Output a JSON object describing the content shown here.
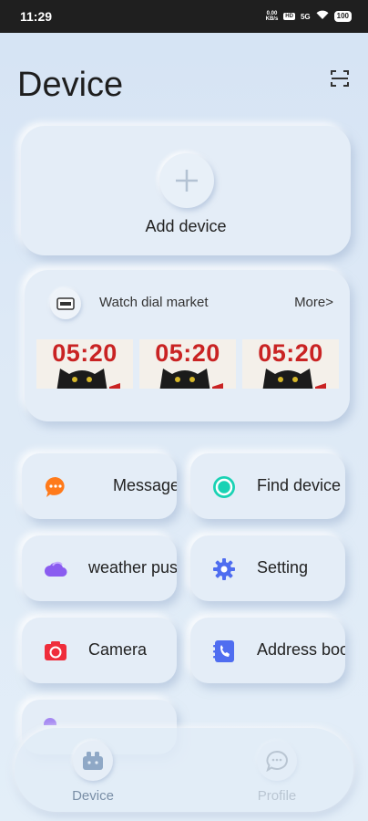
{
  "status_bar": {
    "time": "11:29",
    "speed_value": "0.00",
    "speed_unit": "KB/s",
    "sim_badge": "HD",
    "signal": "5G",
    "battery": "100"
  },
  "header": {
    "title": "Device",
    "scan_icon": "scan-icon"
  },
  "add_device": {
    "label": "Add device"
  },
  "dial_market": {
    "title": "Watch dial market",
    "more_label": "More>",
    "dials": [
      {
        "time": "05:20"
      },
      {
        "time": "05:20"
      },
      {
        "time": "05:20"
      }
    ]
  },
  "features": [
    {
      "label": "Message",
      "icon": "chat-bubble-icon",
      "color": "#ff7a1a"
    },
    {
      "label": "Find device",
      "icon": "find-device-icon",
      "color": "#19d2b4"
    },
    {
      "label": "weather push",
      "icon": "cloud-icon",
      "color": "#8a5cf0"
    },
    {
      "label": "Setting",
      "icon": "gear-icon",
      "color": "#4f6df0"
    },
    {
      "label": "Camera",
      "icon": "camera-icon",
      "color": "#ef2d3b"
    },
    {
      "label": "Address book",
      "icon": "address-book-icon",
      "color": "#4f6df0"
    }
  ],
  "bottom_nav": {
    "items": [
      {
        "label": "Device",
        "icon": "device-icon",
        "active": true
      },
      {
        "label": "Profile",
        "icon": "profile-chat-icon",
        "active": false
      }
    ]
  }
}
